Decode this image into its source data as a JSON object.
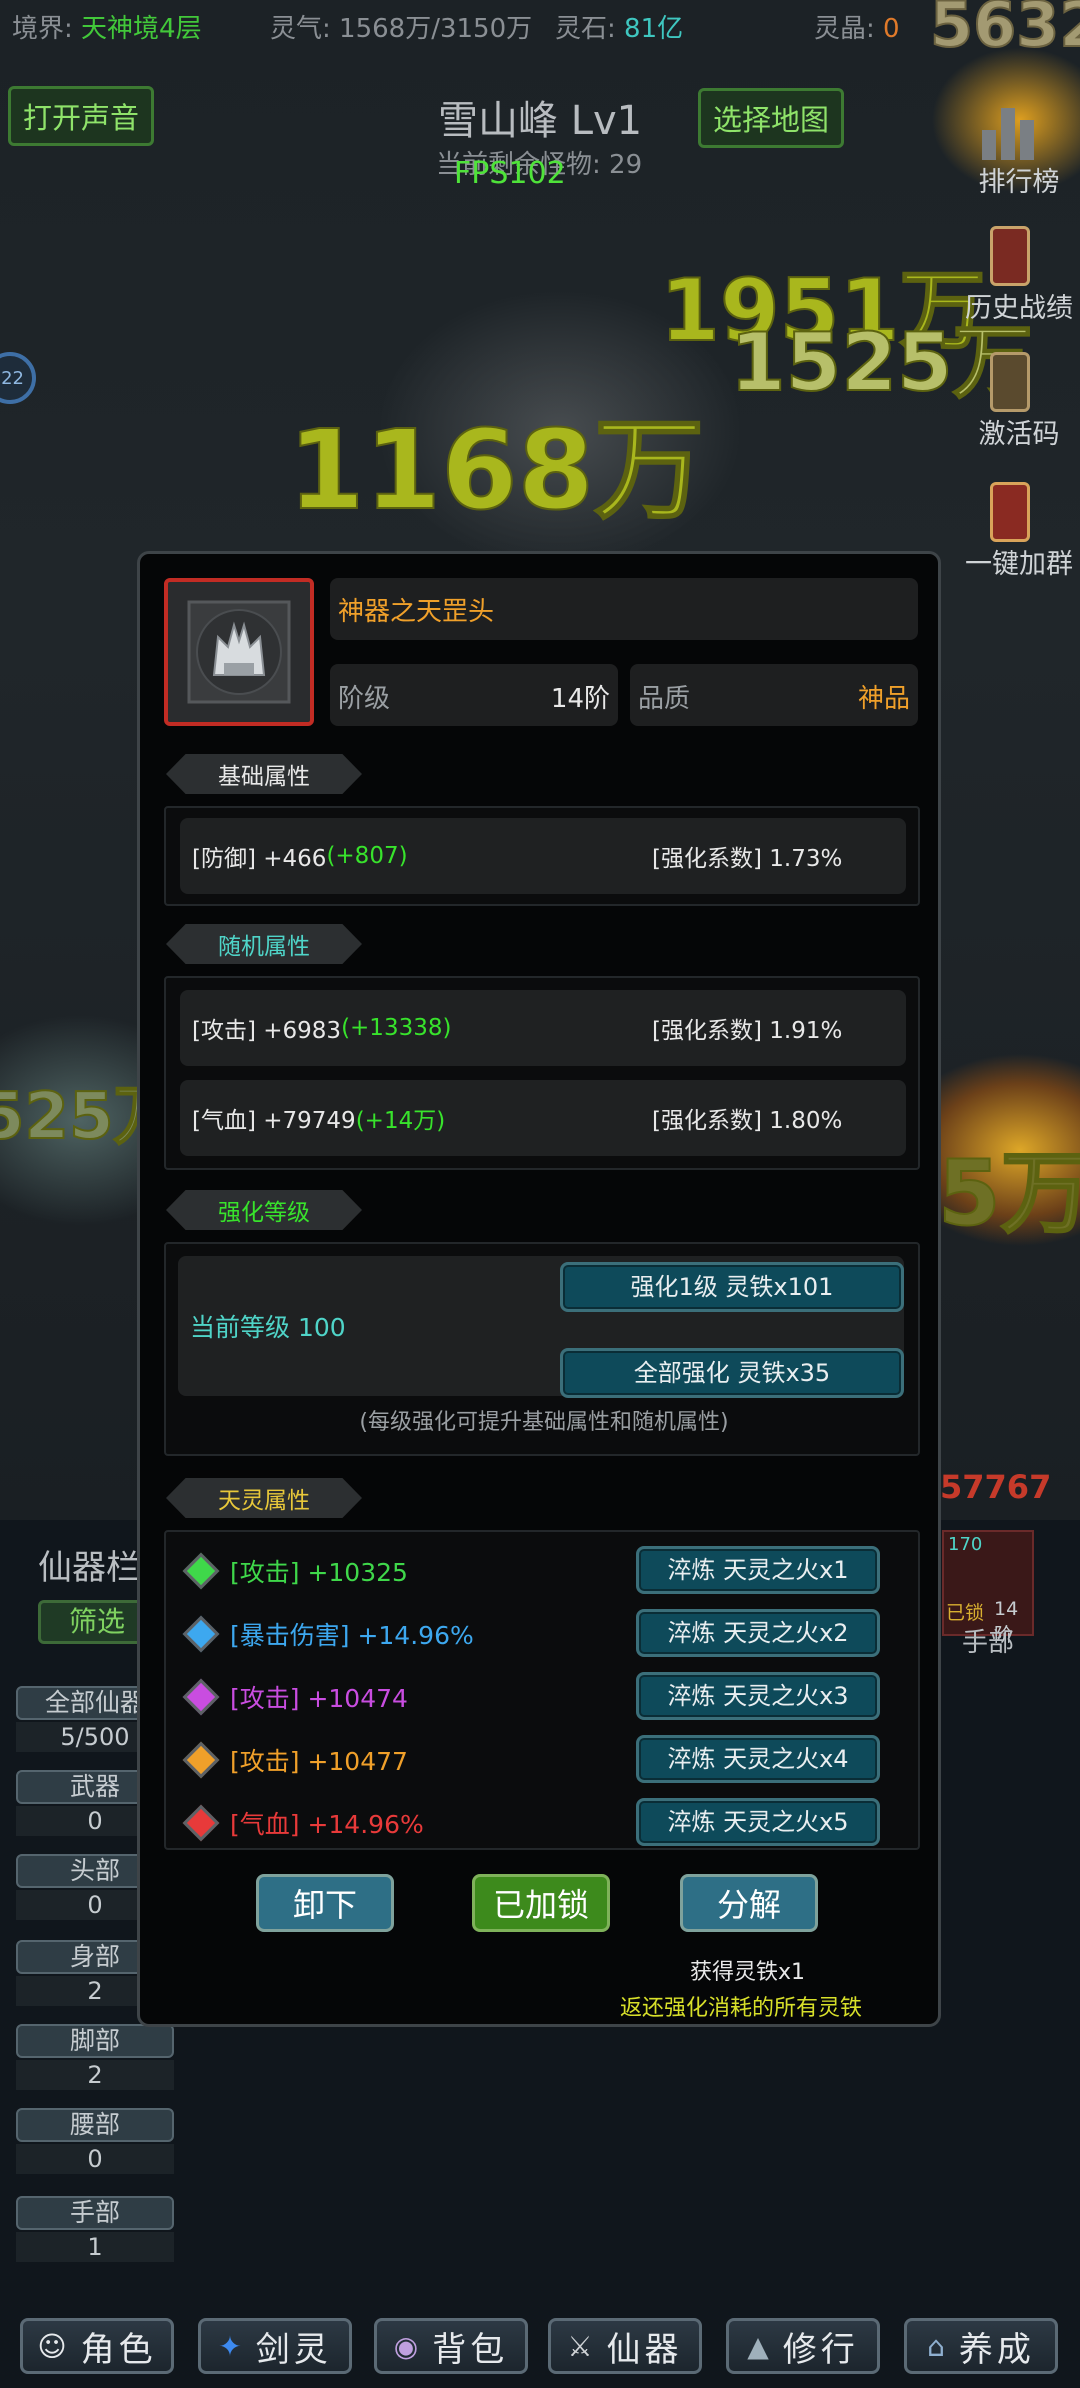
{
  "status_bar": {
    "realm_label": "境界:",
    "realm_value": "天神境4层",
    "qi_label": "灵气:",
    "qi_value": "1568万/3150万",
    "stone_label": "灵石:",
    "stone_value": "81亿",
    "crystal_label": "灵晶:",
    "crystal_value": "0",
    "corner_number": "5632"
  },
  "scene": {
    "sound_button": "打开声音",
    "map_button": "选择地图",
    "map_title": "雪山峰 Lv1",
    "monsters_left": "当前剩余怪物: 29",
    "fps": "FPS102",
    "left_badge": "22",
    "damage_numbers": [
      "1951万",
      "1525万",
      "1168万",
      "525万",
      "5万"
    ],
    "side_menu": [
      {
        "label": "排行榜",
        "icon": "bar-chart-icon"
      },
      {
        "label": "历史战绩",
        "icon": "scroll-icon"
      },
      {
        "label": "激活码",
        "icon": "book-icon"
      },
      {
        "label": "一键加群",
        "icon": "scroll-icon"
      }
    ]
  },
  "background_panel": {
    "title": "仙器栏",
    "filter_button": "筛选",
    "right_value": "57767",
    "right_item": {
      "number": "170",
      "locked": "已锁",
      "tier": "14阶",
      "slot": "手部"
    },
    "categories": [
      {
        "label": "全部仙器",
        "value": "5/500"
      },
      {
        "label": "武器",
        "value": "0"
      },
      {
        "label": "头部",
        "value": "0"
      },
      {
        "label": "身部",
        "value": "2"
      },
      {
        "label": "脚部",
        "value": "2"
      },
      {
        "label": "腰部",
        "value": "0"
      },
      {
        "label": "手部",
        "value": "1"
      }
    ]
  },
  "dialog": {
    "item_name": "神器之天罡头",
    "tier_label": "阶级",
    "tier_value": "14阶",
    "quality_label": "品质",
    "quality_value": "神品",
    "basic_section": "基础属性",
    "basic_attrs": [
      {
        "name": "[防御] +466",
        "bonus": "(+807)",
        "coef": "[强化系数] 1.73%"
      }
    ],
    "random_section": "随机属性",
    "random_attrs": [
      {
        "name": "[攻击] +6983",
        "bonus": "(+13338)",
        "coef": "[强化系数] 1.91%"
      },
      {
        "name": "[气血] +79749",
        "bonus": "(+14万)",
        "coef": "[强化系数] 1.80%"
      }
    ],
    "enhance_section": "强化等级",
    "current_level": "当前等级 100",
    "enhance_one_button": "强化1级 灵铁x101",
    "enhance_all_button": "全部强化 灵铁x35",
    "enhance_note": "(每级强化可提升基础属性和随机属性)",
    "spirit_section": "天灵属性",
    "spirit_attrs": [
      {
        "text": "[攻击] +10325",
        "color": "#3fd84a",
        "button": "淬炼 天灵之火x1"
      },
      {
        "text": "[暴击伤害] +14.96%",
        "color": "#3da8ef",
        "button": "淬炼 天灵之火x2"
      },
      {
        "text": "[攻击] +10474",
        "color": "#c94de0",
        "button": "淬炼 天灵之火x3"
      },
      {
        "text": "[攻击] +10477",
        "color": "#f0a02a",
        "button": "淬炼 天灵之火x4"
      },
      {
        "text": "[气血] +14.96%",
        "color": "#e83a3a",
        "button": "淬炼 天灵之火x5"
      }
    ],
    "unequip_button": "卸下",
    "lock_button": "已加锁",
    "decompose_button": "分解",
    "reward_text": "获得灵铁x1",
    "refund_text": "返还强化消耗的所有灵铁"
  },
  "bottom_nav": [
    {
      "label": "角色",
      "icon": "character-icon"
    },
    {
      "label": "剑灵",
      "icon": "sword-spirit-icon"
    },
    {
      "label": "背包",
      "icon": "bag-icon"
    },
    {
      "label": "仙器",
      "icon": "artifact-icon"
    },
    {
      "label": "修行",
      "icon": "mountain-icon"
    },
    {
      "label": "养成",
      "icon": "temple-icon"
    }
  ],
  "colors": {
    "accent_green": "#38e32c",
    "quality_orange": "#f0a02a",
    "section_teal": "#4fd4c8",
    "button_teal": "#0e4a5a"
  }
}
